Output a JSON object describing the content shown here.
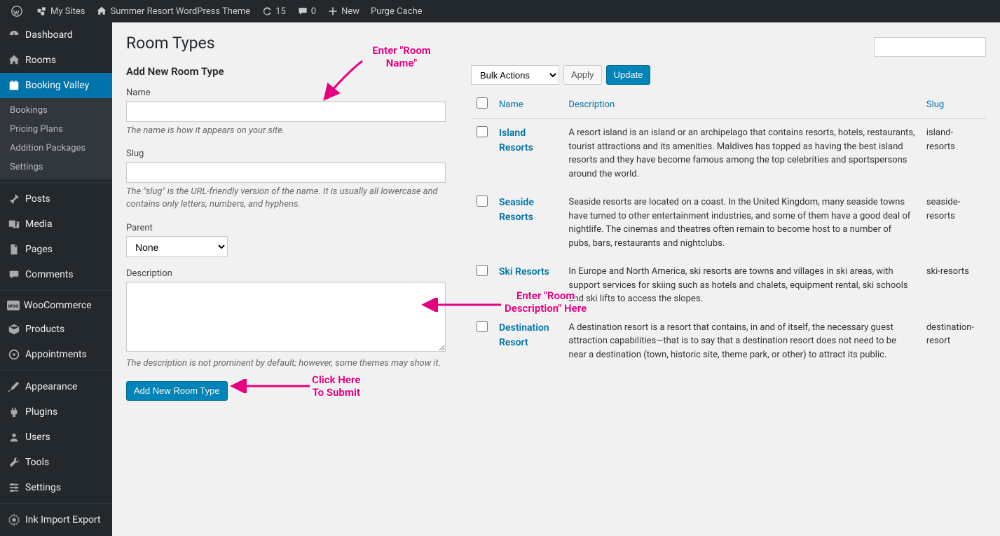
{
  "adminbar": {
    "mysites": "My Sites",
    "siteName": "Summer Resort WordPress Theme",
    "updates": "15",
    "comments": "0",
    "newLabel": "New",
    "purge": "Purge Cache"
  },
  "menu": {
    "dashboard": "Dashboard",
    "rooms": "Rooms",
    "booking": "Booking Valley",
    "sub": {
      "bookings": "Bookings",
      "pricing": "Pricing Plans",
      "packages": "Addition Packages",
      "settings": "Settings"
    },
    "posts": "Posts",
    "media": "Media",
    "pages": "Pages",
    "commentsMenu": "Comments",
    "woo": "WooCommerce",
    "products": "Products",
    "appts": "Appointments",
    "appearance": "Appearance",
    "plugins": "Plugins",
    "users": "Users",
    "tools": "Tools",
    "settingsMenu": "Settings",
    "ink": "Ink Import Export"
  },
  "page": {
    "title": "Room Types",
    "formTitle": "Add New Room Type",
    "nameLabel": "Name",
    "nameHelp": "The name is how it appears on your site.",
    "slugLabel": "Slug",
    "slugHelp": "The \"slug\" is the URL-friendly version of the name. It is usually all lowercase and contains only letters, numbers, and hyphens.",
    "parentLabel": "Parent",
    "parentNone": "None",
    "descLabel": "Description",
    "descHelp": "The description is not prominent by default; however, some themes may show it.",
    "submit": "Add New Room Type",
    "bulkActions": "Bulk Actions",
    "apply": "Apply",
    "update": "Update",
    "col": {
      "name": "Name",
      "desc": "Description",
      "slug": "Slug"
    }
  },
  "rows": [
    {
      "name": "Island Resorts",
      "desc": "A resort island is an island or an archipelago that contains resorts, hotels, restaurants, tourist attractions and its amenities. Maldives has topped as having the best island resorts and they have become famous among the top celebrities and sportspersons around the world.",
      "slug": "island-resorts"
    },
    {
      "name": "Seaside Resorts",
      "desc": "Seaside resorts are located on a coast. In the United Kingdom, many seaside towns have turned to other entertainment industries, and some of them have a good deal of nightlife. The cinemas and theatres often remain to become host to a number of pubs, bars, restaurants and nightclubs.",
      "slug": "seaside-resorts"
    },
    {
      "name": "Ski Resorts",
      "desc": "In Europe and North America, ski resorts are towns and villages in ski areas, with support services for skiing such as hotels and chalets, equipment rental, ski schools and ski lifts to access the slopes.",
      "slug": "ski-resorts"
    },
    {
      "name": "Destination Resort",
      "desc": "A destination resort is a resort that contains, in and of itself, the necessary guest attraction capabilities—that is to say that a destination resort does not need to be near a destination (town, historic site, theme park, or other) to attract its public.",
      "slug": "destination-resort"
    }
  ],
  "annotations": {
    "a1": "Enter \"Room Name\"",
    "a2": "Enter \"Room\nDescription\" Here",
    "a3": "Click Here\nTo Submit"
  }
}
